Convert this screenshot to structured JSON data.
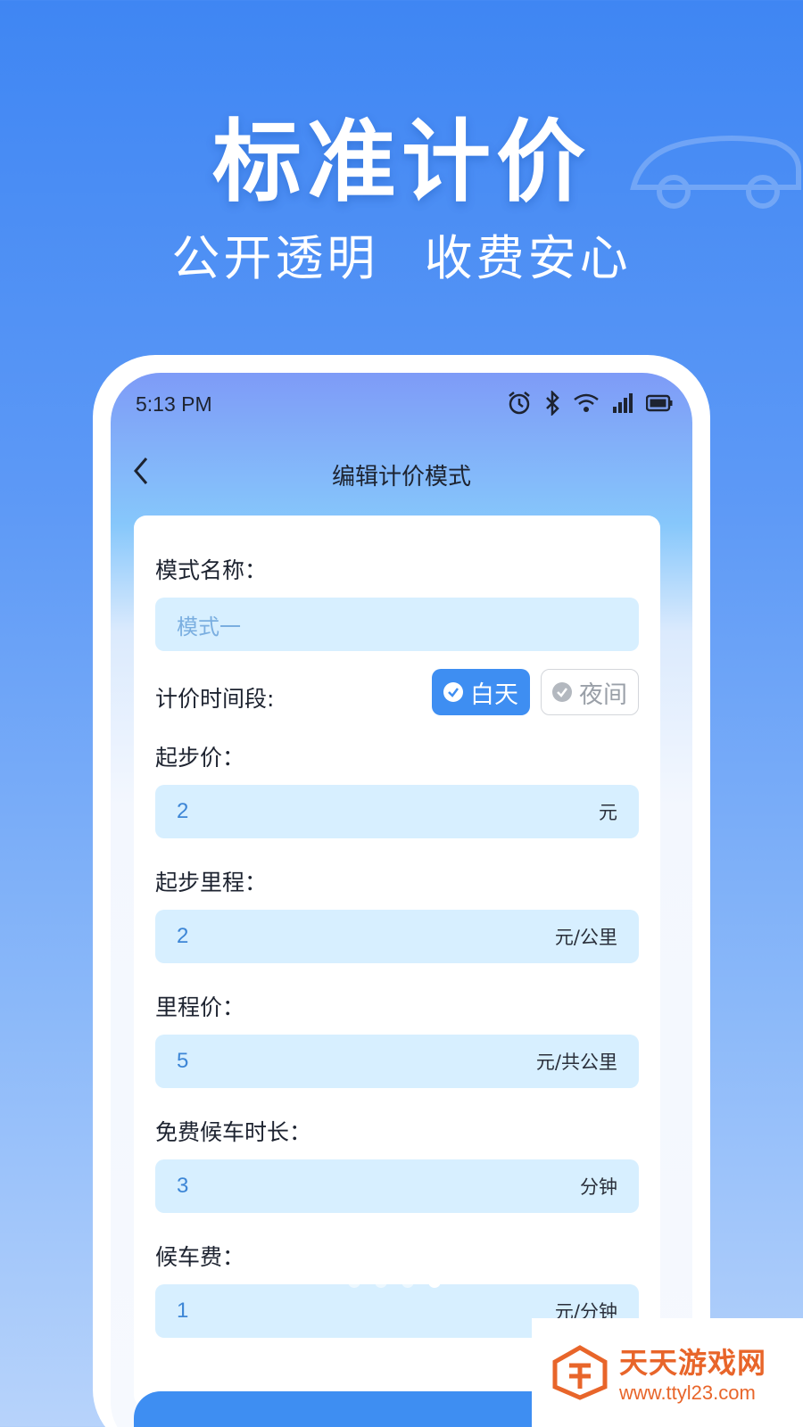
{
  "promo": {
    "title": "标准计价",
    "subtitle": "公开透明  收费安心"
  },
  "status_bar": {
    "time": "5:13 PM",
    "icons": [
      "alarm-icon",
      "bluetooth-icon",
      "wifi-icon",
      "signal-icon",
      "battery-icon"
    ]
  },
  "nav": {
    "back_icon": "chevron-left-icon",
    "title": "编辑计价模式"
  },
  "form": {
    "mode_name": {
      "label": "模式名称：",
      "placeholder": "模式一"
    },
    "period": {
      "label": "计价时间段:",
      "options": [
        {
          "label": "白天",
          "selected": true
        },
        {
          "label": "夜间",
          "selected": false
        }
      ]
    },
    "start_price": {
      "label": "起步价：",
      "value": "2",
      "unit": "元"
    },
    "start_distance": {
      "label": "起步里程：",
      "value": "2",
      "unit": "元/公里"
    },
    "distance_price": {
      "label": "里程价：",
      "value": "5",
      "unit": "元/共公里"
    },
    "free_wait": {
      "label": "免费候车时长：",
      "value": "3",
      "unit": "分钟"
    },
    "wait_fee": {
      "label": "候车费：",
      "value": "1",
      "unit": "元/分钟"
    }
  },
  "pagination": {
    "total": 4,
    "active_index": 3
  },
  "watermark": {
    "name": "天天游戏网",
    "url": "www.ttyl23.com"
  },
  "colors": {
    "primary": "#3e8ef2",
    "input_bg": "#d7efff",
    "input_text": "#3d86d6",
    "watermark": "#e8652a"
  }
}
